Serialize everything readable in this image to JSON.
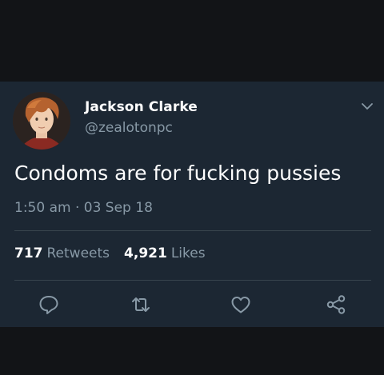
{
  "tweet": {
    "author": {
      "display_name": "Jackson Clarke",
      "handle": "@zealotonpc"
    },
    "text": "Condoms are for fucking pussies",
    "timestamp": "1:50 am · 03 Sep 18",
    "stats": {
      "retweets_count": "717",
      "retweets_label": "Retweets",
      "likes_count": "4,921",
      "likes_label": "Likes"
    },
    "actions": [
      "reply-icon",
      "retweet-icon",
      "like-icon",
      "share-icon"
    ]
  },
  "colors": {
    "card_background": "#1c2733",
    "outer_background": "#121417",
    "primary_text": "#ffffff",
    "secondary_text": "#8899a6",
    "divider": "#38444d"
  }
}
